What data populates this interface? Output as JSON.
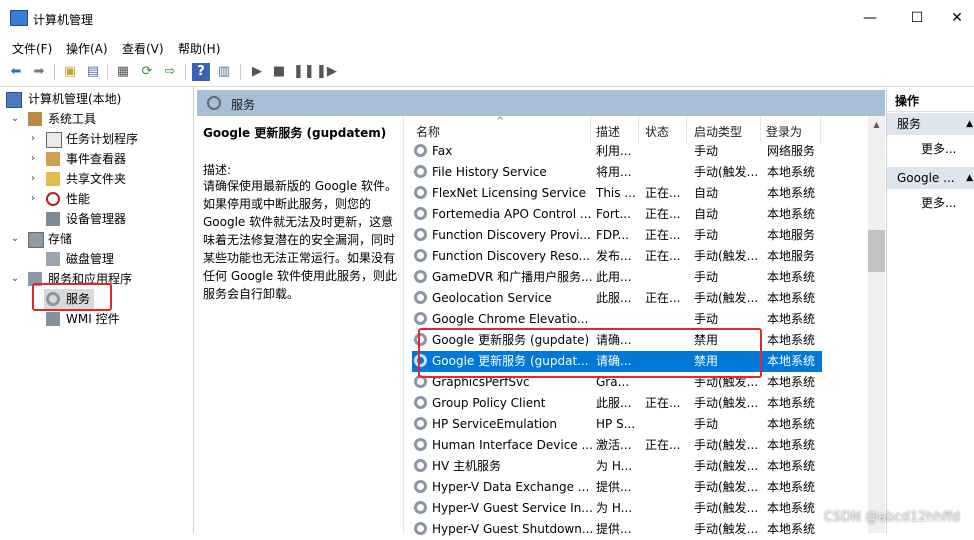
{
  "window": {
    "title": "计算机管理",
    "min": "—",
    "max": "☐",
    "close": "✕"
  },
  "menu": [
    "文件(F)",
    "操作(A)",
    "查看(V)",
    "帮助(H)"
  ],
  "toolbar_icons": [
    "back-arrow-icon",
    "forward-arrow-icon",
    "folder-up-icon",
    "show-tree-icon",
    "properties-icon",
    "refresh-icon",
    "export-icon",
    "help-icon",
    "view-icon",
    "play-icon",
    "stop-icon",
    "pause-icon",
    "resume-icon"
  ],
  "tree": {
    "root": "计算机管理(本地)",
    "system_tools": "系统工具",
    "task_scheduler": "任务计划程序",
    "event_viewer": "事件查看器",
    "shared_folders": "共享文件夹",
    "performance": "性能",
    "device_manager": "设备管理器",
    "storage": "存储",
    "disk_management": "磁盘管理",
    "services_apps": "服务和应用程序",
    "services": "服务",
    "wmi": "WMI 控件"
  },
  "center": {
    "header": "服务",
    "service_title": "Google 更新服务 (gupdatem)",
    "desc_label": "描述:",
    "desc_text": "请确保使用最新版的 Google 软件。如果停用或中断此服务，则您的 Google 软件就无法及时更新，这意味着无法修复潜在的安全漏洞，同时某些功能也无法正常运行。如果没有任何 Google 软件使用此服务，则此服务会自行卸载。"
  },
  "columns": [
    "名称",
    "描述",
    "状态",
    "启动类型",
    "登录为"
  ],
  "sort_arrow": "^",
  "services": [
    {
      "name": "Fax",
      "desc": "利用...",
      "status": "",
      "startup": "手动",
      "logon": "网络服务"
    },
    {
      "name": "File History Service",
      "desc": "将用...",
      "status": "",
      "startup": "手动(触发...",
      "logon": "本地系统"
    },
    {
      "name": "FlexNet Licensing Service",
      "desc": "This ...",
      "status": "正在...",
      "startup": "自动",
      "logon": "本地系统"
    },
    {
      "name": "Fortemedia APO Control ...",
      "desc": "Fort...",
      "status": "正在...",
      "startup": "自动",
      "logon": "本地系统"
    },
    {
      "name": "Function Discovery Provi...",
      "desc": "FDP...",
      "status": "正在...",
      "startup": "手动",
      "logon": "本地服务"
    },
    {
      "name": "Function Discovery Reso...",
      "desc": "发布...",
      "status": "正在...",
      "startup": "手动(触发...",
      "logon": "本地服务"
    },
    {
      "name": "GameDVR 和广播用户服务...",
      "desc": "此用...",
      "status": "",
      "startup": "手动",
      "logon": "本地系统"
    },
    {
      "name": "Geolocation Service",
      "desc": "此服...",
      "status": "正在...",
      "startup": "手动(触发...",
      "logon": "本地系统"
    },
    {
      "name": "Google Chrome Elevatio...",
      "desc": "",
      "status": "",
      "startup": "手动",
      "logon": "本地系统"
    },
    {
      "name": "Google 更新服务 (gupdate)",
      "desc": "请确...",
      "status": "",
      "startup": "禁用",
      "logon": "本地系统"
    },
    {
      "name": "Google 更新服务 (gupdat...",
      "desc": "请确...",
      "status": "",
      "startup": "禁用",
      "logon": "本地系统"
    },
    {
      "name": "GraphicsPerfSvc",
      "desc": "Gra...",
      "status": "",
      "startup": "手动(触发...",
      "logon": "本地系统"
    },
    {
      "name": "Group Policy Client",
      "desc": "此服...",
      "status": "正在...",
      "startup": "手动(触发...",
      "logon": "本地系统"
    },
    {
      "name": "HP ServiceEmulation",
      "desc": "HP S...",
      "status": "",
      "startup": "手动",
      "logon": "本地系统"
    },
    {
      "name": "Human Interface Device ...",
      "desc": "激活...",
      "status": "正在...",
      "startup": "手动(触发...",
      "logon": "本地系统"
    },
    {
      "name": "HV 主机服务",
      "desc": "为 H...",
      "status": "",
      "startup": "手动(触发...",
      "logon": "本地系统"
    },
    {
      "name": "Hyper-V Data Exchange ...",
      "desc": "提供...",
      "status": "",
      "startup": "手动(触发...",
      "logon": "本地系统"
    },
    {
      "name": "Hyper-V Guest Service In...",
      "desc": "为 H...",
      "status": "",
      "startup": "手动(触发...",
      "logon": "本地系统"
    },
    {
      "name": "Hyper-V Guest Shutdown...",
      "desc": "提供...",
      "status": "",
      "startup": "手动(触发...",
      "logon": "本地系统"
    }
  ],
  "selected_index": 10,
  "actions": {
    "header": "操作",
    "section1": "服务",
    "more1": "更多...",
    "section2": "Google ...",
    "more2": "更多..."
  },
  "watermark": "CSDN @abcd12hhffd",
  "colors": {
    "selection": "#0078d7",
    "highlight_box": "#e3262b",
    "panel_header": "#a9bfd6"
  }
}
